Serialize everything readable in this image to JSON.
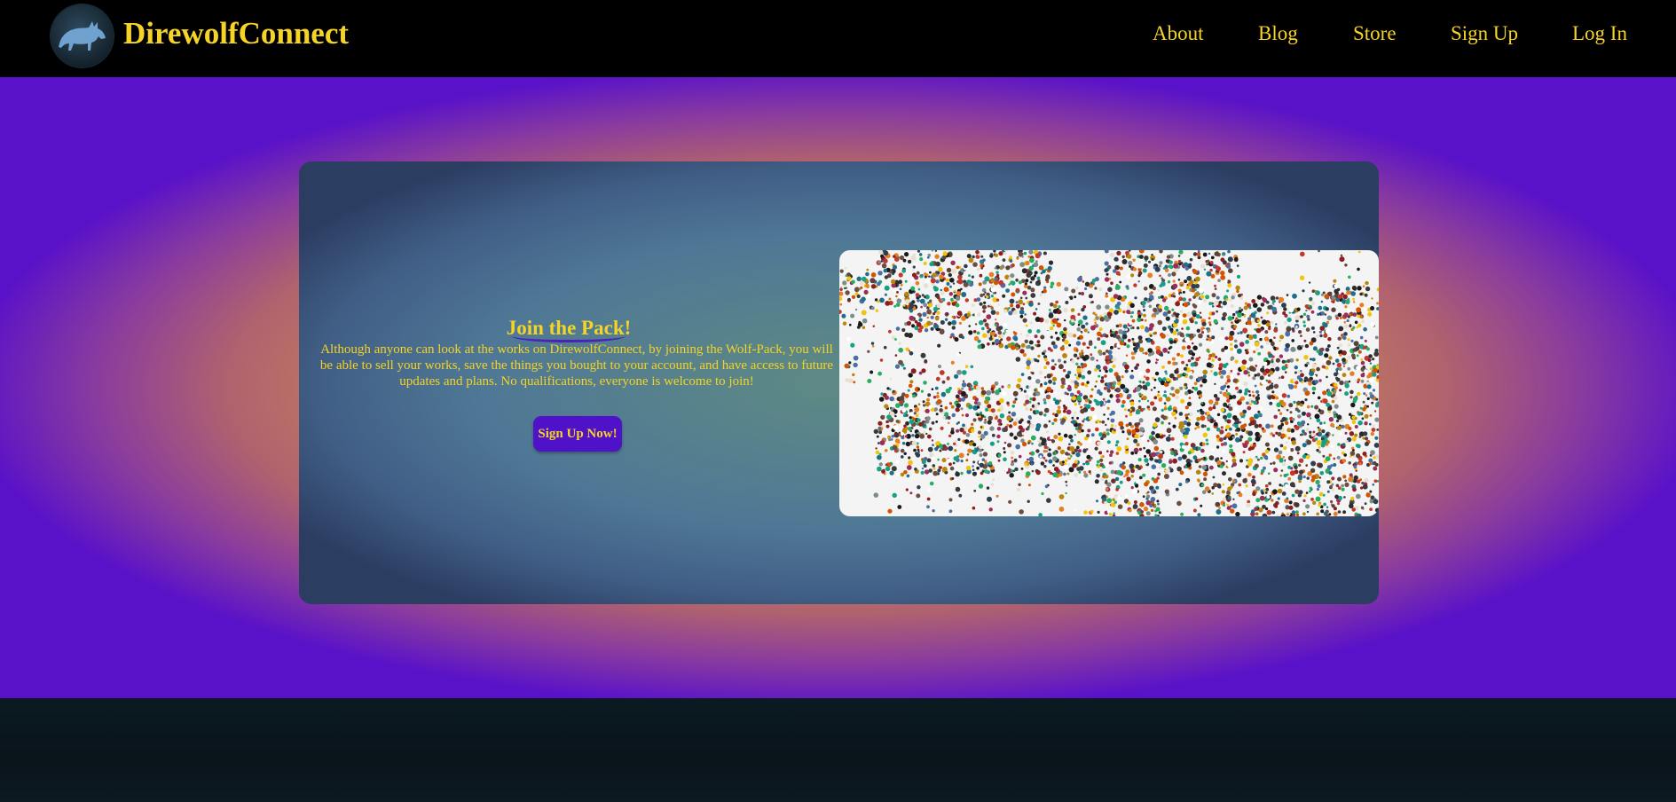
{
  "header": {
    "brand": "DirewolfConnect",
    "logo_icon": "wolf-logo-icon",
    "nav": [
      "About",
      "Blog",
      "Store",
      "Sign Up",
      "Log In"
    ]
  },
  "hero": {
    "title": "Join the Pack!",
    "description": "Although anyone can look at the works on DirewolfConnect, by joining the Wolf-Pack, you will be able to sell your works, save the things you bought to your account, and have access to future updates and plans. No qualifications, everyone is welcome to join!",
    "button_label": "Sign Up Now!",
    "image_subject": "crowd-image"
  },
  "colors": {
    "accent_text": "#f5d327",
    "nav_bg": "#000000",
    "hero_edge": "#5a12c8",
    "button_bg": "#5012c8"
  }
}
